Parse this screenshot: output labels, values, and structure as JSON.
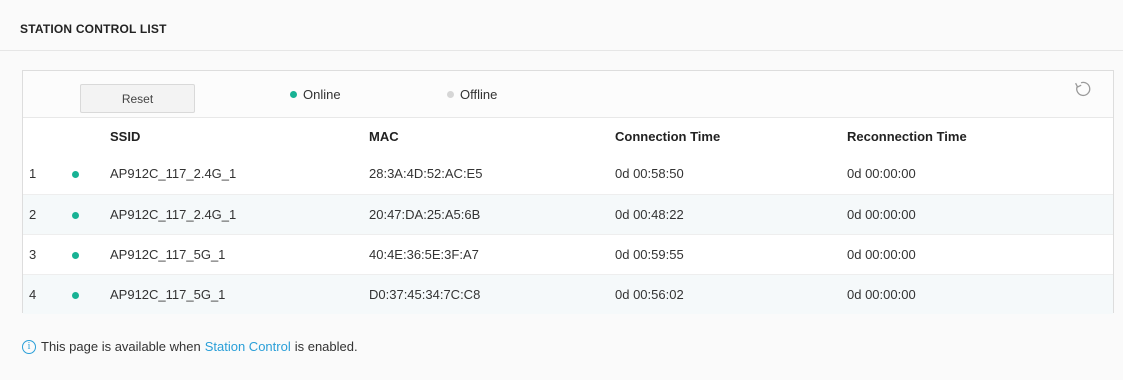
{
  "header": {
    "title": "STATION CONTROL LIST"
  },
  "toolbar": {
    "reset_label": "Reset",
    "legend_online": "Online",
    "legend_offline": "Offline",
    "refresh_icon": "refresh-icon"
  },
  "table": {
    "columns": [
      "",
      "",
      "SSID",
      "MAC",
      "Connection Time",
      "Reconnection Time"
    ],
    "rows": [
      {
        "index": "1",
        "status": "online",
        "ssid": "AP912C_117_2.4G_1",
        "mac": "28:3A:4D:52:AC:E5",
        "connection_time": "0d 00:58:50",
        "reconnection_time": "0d 00:00:00"
      },
      {
        "index": "2",
        "status": "online",
        "ssid": "AP912C_117_2.4G_1",
        "mac": "20:47:DA:25:A5:6B",
        "connection_time": "0d 00:48:22",
        "reconnection_time": "0d 00:00:00"
      },
      {
        "index": "3",
        "status": "online",
        "ssid": "AP912C_117_5G_1",
        "mac": "40:4E:36:5E:3F:A7",
        "connection_time": "0d 00:59:55",
        "reconnection_time": "0d 00:00:00"
      },
      {
        "index": "4",
        "status": "online",
        "ssid": "AP912C_117_5G_1",
        "mac": "D0:37:45:34:7C:C8",
        "connection_time": "0d 00:56:02",
        "reconnection_time": "0d 00:00:00"
      }
    ]
  },
  "note": {
    "prefix": "This page is available when",
    "link": "Station Control",
    "suffix": "is enabled."
  },
  "colors": {
    "online": "#17b294",
    "offline": "#d6d6d6",
    "link": "#2a9fd8"
  }
}
